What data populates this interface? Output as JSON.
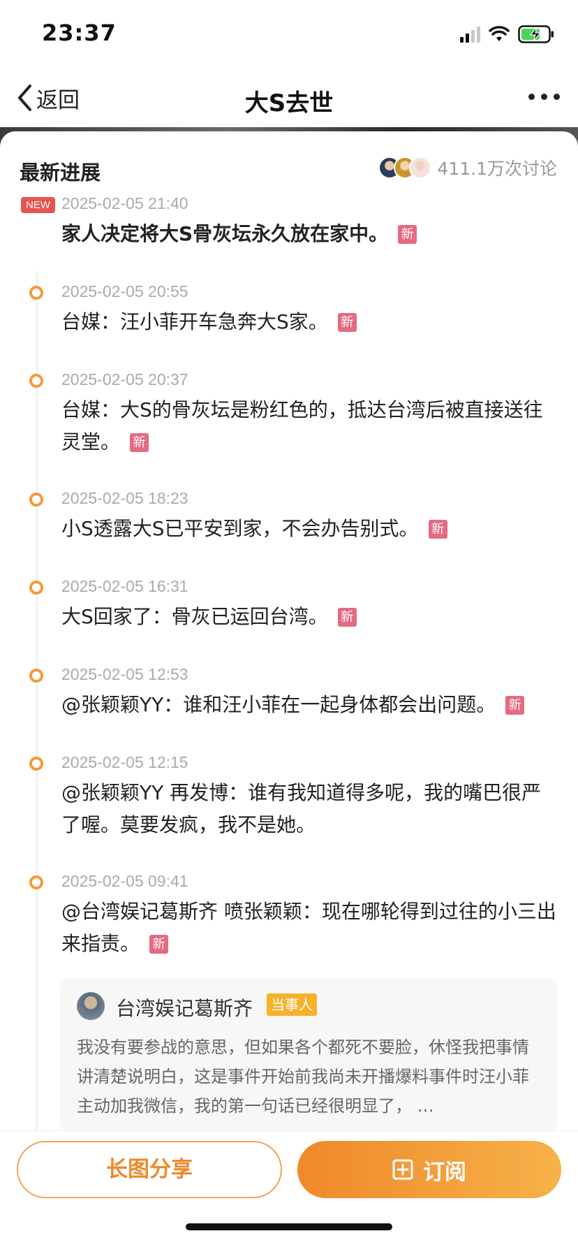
{
  "status_bar": {
    "time": "23:37"
  },
  "nav": {
    "back_label": "返回",
    "title": "大S去世"
  },
  "section": {
    "title": "最新进展",
    "discussion_count": "411.1万次讨论",
    "new_badge": "NEW"
  },
  "timeline": [
    {
      "time": "2025-02-05 21:40",
      "text": "家人决定将大S骨灰坛永久放在家中。",
      "tag": "新"
    },
    {
      "time": "2025-02-05 20:55",
      "text": "台媒：汪小菲开车急奔大S家。",
      "tag": "新"
    },
    {
      "time": "2025-02-05 20:37",
      "text": "台媒：大S的骨灰坛是粉红色的，抵达台湾后被直接送往灵堂。",
      "tag": "新"
    },
    {
      "time": "2025-02-05 18:23",
      "text": "小S透露大S已平安到家，不会办告别式。",
      "tag": "新"
    },
    {
      "time": "2025-02-05 16:31",
      "text": "大S回家了：骨灰已运回台湾。",
      "tag": "新"
    },
    {
      "time": "2025-02-05 12:53",
      "text": "@张颖颖YY：谁和汪小菲在一起身体都会出问题。",
      "tag": "新"
    },
    {
      "time": "2025-02-05 12:15",
      "text": "@张颖颖YY 再发博：谁有我知道得多呢，我的嘴巴很严了喔。莫要发疯，我不是她。",
      "tag": ""
    },
    {
      "time": "2025-02-05 09:41",
      "text": "@台湾娱记葛斯齐 喷张颖颖：现在哪轮得到过往的小三出来指责。",
      "tag": "新"
    }
  ],
  "quote": {
    "author": "台湾娱记葛斯齐",
    "author_tag": "当事人",
    "body": "我没有要参战的意思，但如果各个都死不要脸，休怪我把事情讲清楚说明白，这是事件开始前我尚未开播爆料事件时汪小菲主动加我微信，我的第一句话已经很明显了，  …"
  },
  "bottom": {
    "share_label": "长图分享",
    "subscribe_label": "订阅"
  },
  "colors": {
    "accent": "#f0882a",
    "timeline_dot": "#f39a3e",
    "new_tag": "#e46a82",
    "new_badge": "#e9534f",
    "author_tag": "#f7b22a"
  }
}
